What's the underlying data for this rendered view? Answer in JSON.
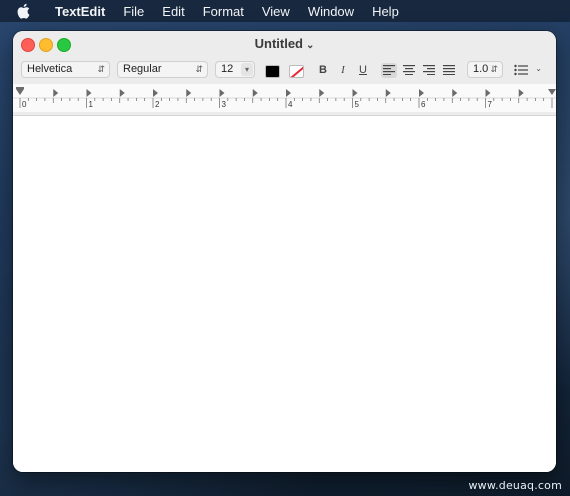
{
  "menubar": {
    "app_name": "TextEdit",
    "items": [
      "File",
      "Edit",
      "Format",
      "View",
      "Window",
      "Help"
    ]
  },
  "window": {
    "title": "Untitled",
    "traffic_lights": {
      "close": "#fe5f57",
      "minimize": "#febc2e",
      "zoom": "#28c840"
    }
  },
  "toolbar": {
    "font_family": "Helvetica",
    "font_style": "Regular",
    "font_size": "12",
    "text_color": "#000000",
    "bold_label": "B",
    "italic_label": "I",
    "underline_label": "U",
    "line_spacing": "1.0",
    "alignment": "left"
  },
  "ruler": {
    "numbers": [
      "0",
      "1",
      "2",
      "3",
      "4",
      "5",
      "6",
      "7"
    ]
  },
  "document": {
    "content": ""
  },
  "watermark": "www.deuaq.com"
}
